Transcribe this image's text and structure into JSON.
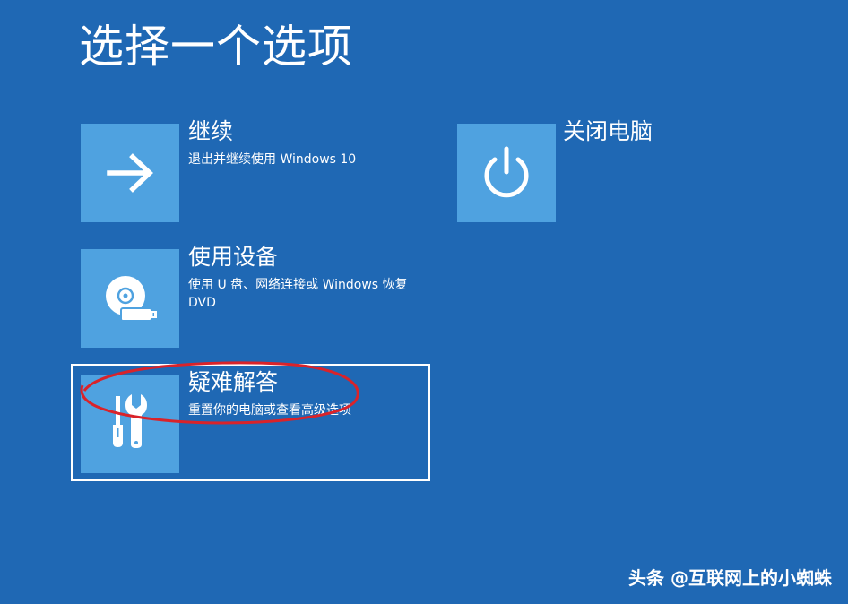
{
  "page": {
    "title": "选择一个选项",
    "background_color": "#1f68b4",
    "tile_color": "#4fa2e0",
    "annotation_color": "#d9232a"
  },
  "options": {
    "continue": {
      "title": "继续",
      "description": "退出并继续使用 Windows 10",
      "icon": "arrow-right-icon"
    },
    "use_device": {
      "title": "使用设备",
      "description": "使用 U 盘、网络连接或 Windows 恢复 DVD",
      "icon": "disc-usb-icon"
    },
    "troubleshoot": {
      "title": "疑难解答",
      "description": "重置你的电脑或查看高级选项",
      "icon": "tools-icon",
      "selected": true
    },
    "shutdown": {
      "title": "关闭电脑",
      "description": "",
      "icon": "power-icon"
    }
  },
  "watermark": "头条 @互联网上的小蜘蛛"
}
